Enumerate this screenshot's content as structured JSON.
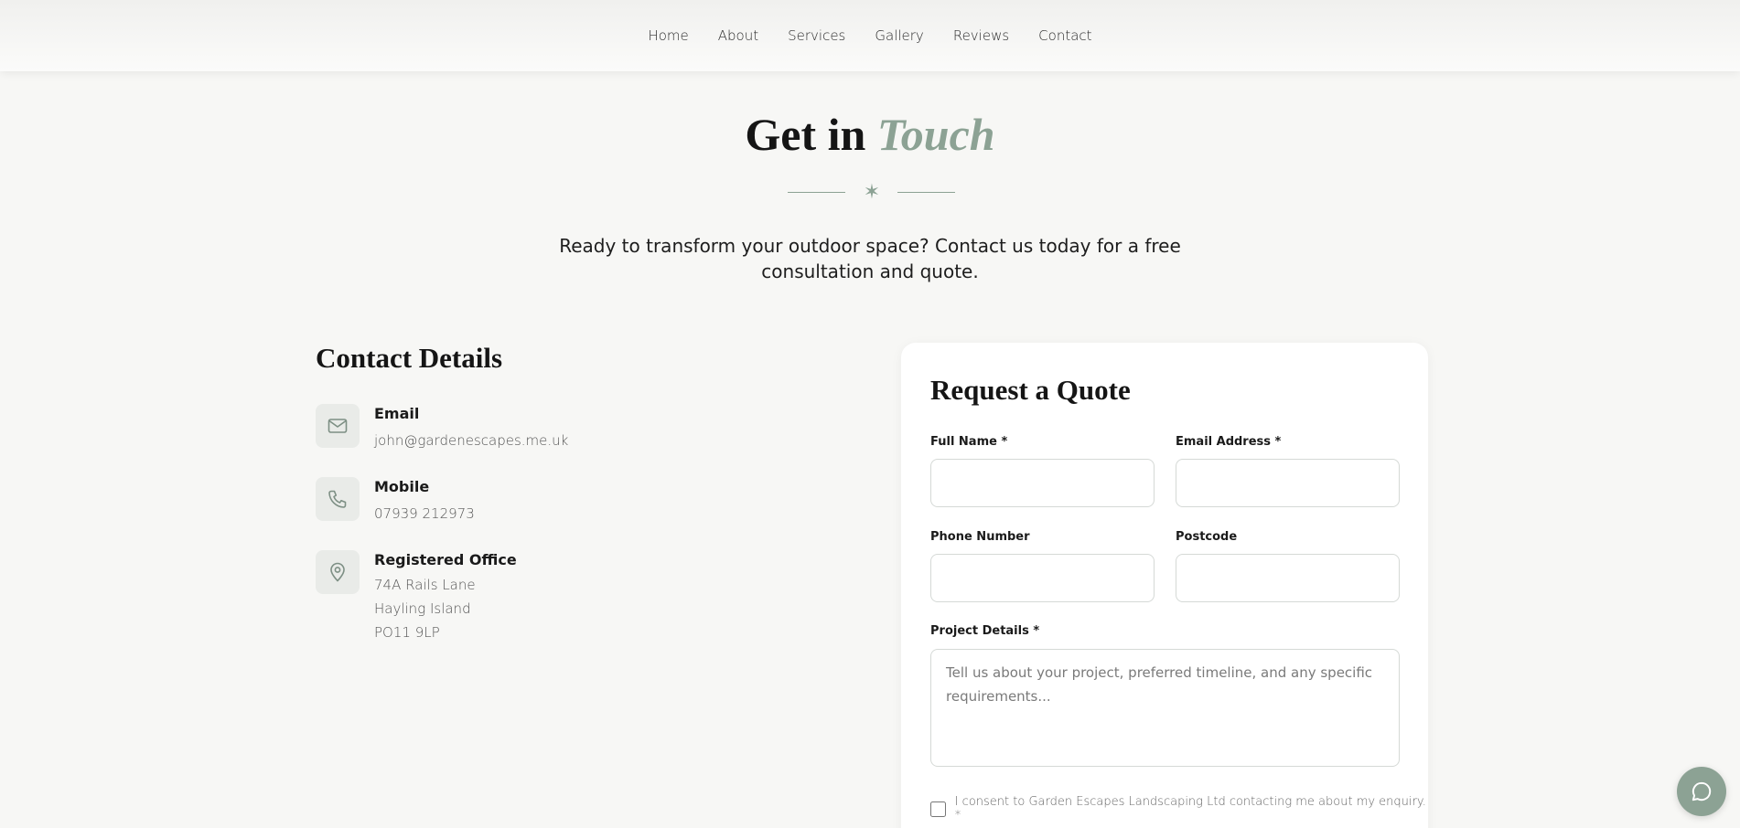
{
  "nav": {
    "items": [
      {
        "label": "Home"
      },
      {
        "label": "About"
      },
      {
        "label": "Services"
      },
      {
        "label": "Gallery"
      },
      {
        "label": "Reviews"
      },
      {
        "label": "Contact"
      }
    ]
  },
  "hero": {
    "title_plain": "Get in",
    "title_accent": "Touch",
    "divider_symbol": "✶",
    "subtitle": "Ready to transform your outdoor space? Contact us today for a free consultation and quote."
  },
  "contact": {
    "heading": "Contact Details",
    "email": {
      "label": "Email",
      "value": "john@gardenescapes.me.uk",
      "icon": "mail-icon"
    },
    "mobile": {
      "label": "Mobile",
      "value": "07939 212973",
      "icon": "phone-icon"
    },
    "office": {
      "label": "Registered Office",
      "line1": "74A Rails Lane",
      "line2": "Hayling Island",
      "line3": "PO11 9LP",
      "icon": "map-pin-icon"
    }
  },
  "quote_form": {
    "heading": "Request a Quote",
    "full_name_label": "Full Name *",
    "email_label": "Email Address *",
    "phone_label": "Phone Number",
    "postcode_label": "Postcode",
    "project_label": "Project Details *",
    "project_placeholder": "Tell us about your project, preferred timeline, and any specific requirements...",
    "consent_text": "I consent to Garden Escapes Landscaping Ltd contacting me about my enquiry. *"
  },
  "chat": {
    "icon": "chat-bubble-icon"
  },
  "colors": {
    "accent": "#8ca294",
    "background": "#f7f7f5",
    "card": "#ffffff"
  }
}
